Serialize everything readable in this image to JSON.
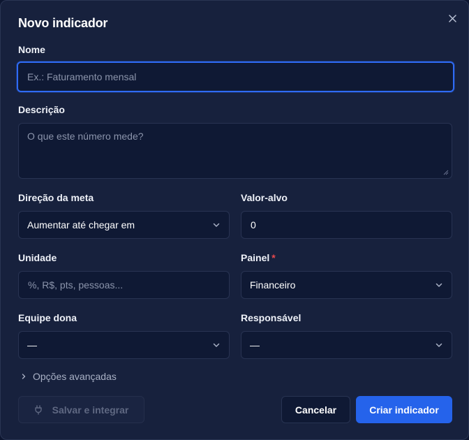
{
  "dialog": {
    "title": "Novo indicador",
    "close_icon": "close-icon"
  },
  "form": {
    "nome": {
      "label": "Nome",
      "value": "",
      "placeholder": "Ex.: Faturamento mensal"
    },
    "descricao": {
      "label": "Descrição",
      "value": "",
      "placeholder": "O que este número mede?"
    },
    "direcao": {
      "label": "Direção da meta",
      "selected": "Aumentar até chegar em"
    },
    "valor_alvo": {
      "label": "Valor-alvo",
      "value": "0"
    },
    "unidade": {
      "label": "Unidade",
      "value": "",
      "placeholder": "%, R$, pts, pessoas..."
    },
    "painel": {
      "label": "Painel",
      "required_mark": "*",
      "selected": "Financeiro"
    },
    "equipe": {
      "label": "Equipe dona",
      "selected": "—"
    },
    "responsavel": {
      "label": "Responsável",
      "selected": "—"
    }
  },
  "advanced": {
    "label": "Opções avançadas"
  },
  "buttons": {
    "integrate": "Salvar e integrar",
    "cancel": "Cancelar",
    "create": "Criar indicador"
  },
  "colors": {
    "dialog_bg": "#17213d",
    "field_bg": "#0f1934",
    "accent": "#2563eb",
    "focus_border": "#2f6bf5",
    "required": "#e5484d"
  }
}
